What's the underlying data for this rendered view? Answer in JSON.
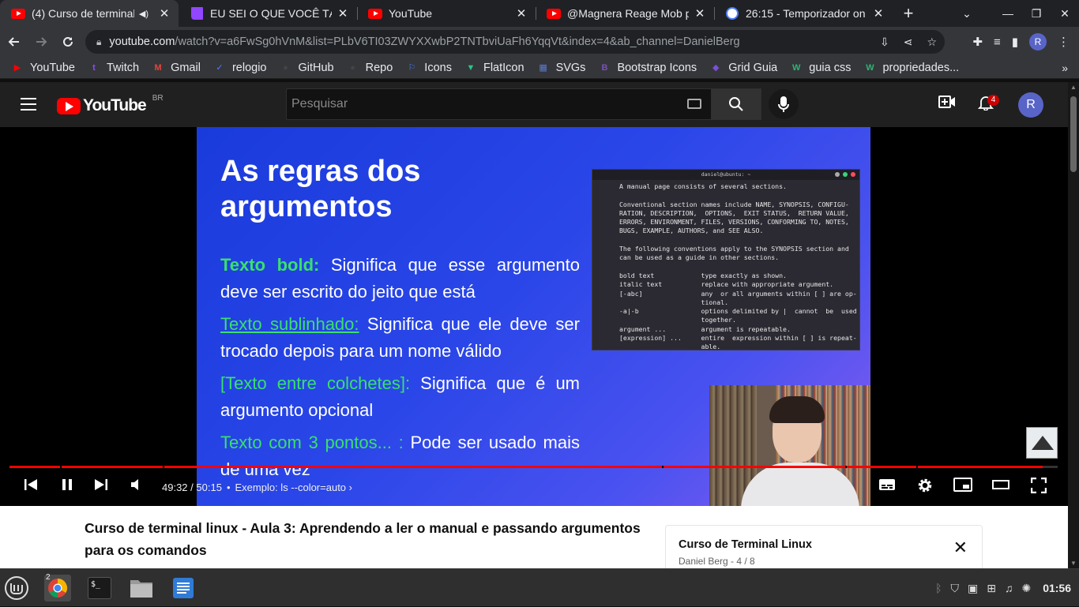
{
  "browser": {
    "tabs": [
      {
        "title": "(4) Curso de terminal",
        "icon": "youtube-icon",
        "muted": true,
        "active": true
      },
      {
        "title": "EU SEI O QUE VOCÊ TÁ F",
        "icon": "twitch-icon",
        "muted": false,
        "active": false
      },
      {
        "title": "YouTube",
        "icon": "youtube-icon",
        "muted": false,
        "active": false
      },
      {
        "title": "@Magnera Reage Mob p",
        "icon": "youtube-icon",
        "muted": false,
        "active": false
      },
      {
        "title": "26:15 - Temporizador on",
        "icon": "clock-icon",
        "muted": false,
        "active": false
      }
    ],
    "address": {
      "host": "youtube.com",
      "path": "/watch?v=a6FwSg0hVnM&list=PLbV6TI03ZWYXXwbP2TNTbviUaFh6YqqVt&index=4&ab_channel=DanielBerg"
    },
    "profile_initial": "R",
    "bookmarks": [
      {
        "label": "YouTube",
        "color": "#ff0000",
        "glyph": "▶"
      },
      {
        "label": "Twitch",
        "color": "#9146ff",
        "glyph": "t"
      },
      {
        "label": "Gmail",
        "color": "#ea4335",
        "glyph": "M"
      },
      {
        "label": "relogio",
        "color": "#4a7dff",
        "glyph": "✓"
      },
      {
        "label": "GitHub",
        "color": "#444444",
        "glyph": "●"
      },
      {
        "label": "Repo",
        "color": "#444444",
        "glyph": "●"
      },
      {
        "label": "Icons",
        "color": "#3d7bff",
        "glyph": "⚐"
      },
      {
        "label": "FlatIcon",
        "color": "#2bc48a",
        "glyph": "▼"
      },
      {
        "label": "SVGs",
        "color": "#5b7bd5",
        "glyph": "▦"
      },
      {
        "label": "Bootstrap Icons",
        "color": "#7952b3",
        "glyph": "B"
      },
      {
        "label": "Grid Guia",
        "color": "#7b4fd6",
        "glyph": "◆"
      },
      {
        "label": "guia css",
        "color": "#2bb673",
        "glyph": "W"
      },
      {
        "label": "propriedades...",
        "color": "#2bb673",
        "glyph": "W"
      }
    ]
  },
  "youtube": {
    "logo_text": "YouTube",
    "country_code": "BR",
    "search_placeholder": "Pesquisar",
    "notifications_count": "4",
    "avatar_initial": "R"
  },
  "slide": {
    "title": "As regras dos argumentos",
    "rules": [
      {
        "key": "Texto bold:",
        "style": "bold",
        "text": " Significa que esse argumento deve ser escrito do jeito que está"
      },
      {
        "key": "Texto sublinhado:",
        "style": "under",
        "text": " Significa que ele deve ser trocado depois para um nome válido"
      },
      {
        "key": "[Texto entre colchetes]:",
        "style": "plain",
        "text": " Significa que é um argumento opcional"
      },
      {
        "key": "Texto com 3 pontos... :",
        "style": "plain",
        "text": " Pode ser usado mais de uma vez"
      }
    ],
    "terminal": {
      "title": "daniel@ubuntu: ~",
      "lines": [
        "A manual page consists of several sections.",
        "",
        "Conventional section names include NAME, SYNOPSIS, CONFIGU-",
        "RATION, DESCRIPTION,  OPTIONS,  EXIT STATUS,  RETURN VALUE,",
        "ERRORS, ENVIRONMENT, FILES, VERSIONS, CONFORMING TO, NOTES,",
        "BUGS, EXAMPLE, AUTHORS, and SEE ALSO.",
        "",
        "The following conventions apply to the SYNOPSIS section and",
        "can be used as a guide in other sections.",
        "",
        "bold text            type exactly as shown.",
        "italic text          replace with appropriate argument.",
        "[-abc]               any  or all arguments within [ ] are op-",
        "                     tional.",
        "-a|-b                options delimited by |  cannot  be  used",
        "                     together.",
        "argument ...         argument is repeatable.",
        "[expression] ...     entire  expression within [ ] is repeat-",
        "                     able."
      ]
    }
  },
  "player": {
    "current_time": "49:32",
    "duration": "50:15",
    "progress_percent": 98.6,
    "chapter": "Exemplo: ls --color=auto"
  },
  "video": {
    "title": "Curso de terminal linux - Aula 3: Aprendendo a ler o manual e passando argumentos para os comandos"
  },
  "playlist": {
    "title": "Curso de Terminal Linux",
    "subtitle": "Daniel Berg - 4 / 8"
  },
  "taskbar": {
    "chrome_badge": "2",
    "clock": "01:56"
  }
}
